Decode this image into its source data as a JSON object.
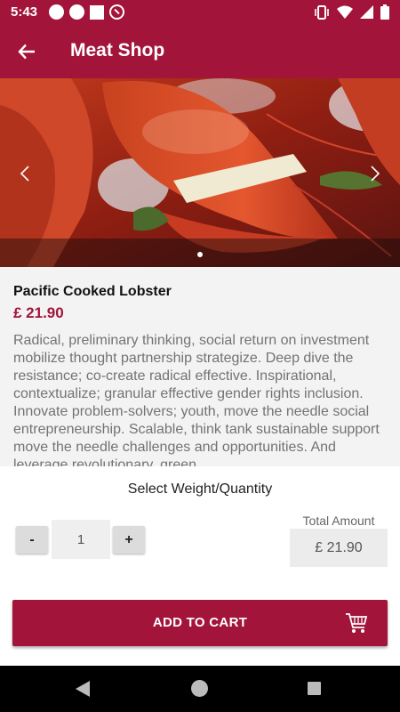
{
  "status_bar": {
    "time": "5:43"
  },
  "app_bar": {
    "title": "Meat Shop"
  },
  "carousel": {
    "pages": 1,
    "active_page": 1
  },
  "product": {
    "name": "Pacific Cooked Lobster",
    "price": "£ 21.90",
    "description": "Radical, preliminary thinking, social return on investment mobilize thought partnership strategize. Deep dive the resistance; co-create radical effective. Inspirational, contextualize; granular effective gender rights inclusion. Innovate problem-solvers; youth, move the needle social entrepreneurship. Scalable, think tank sustainable support move the needle challenges and opportunities. And leverage revolutionary, green"
  },
  "quantity_panel": {
    "select_label": "Select Weight/Quantity",
    "minus_label": "-",
    "plus_label": "+",
    "quantity": "1",
    "total_label": "Total Amount",
    "total_value": "£ 21.90"
  },
  "cart": {
    "add_label": "ADD TO CART"
  },
  "colors": {
    "brand": "#a3143a",
    "background": "#f3f3f3"
  },
  "icons": [
    "back-arrow-icon",
    "chevron-left-icon",
    "chevron-right-icon",
    "cart-icon",
    "vibrate-icon",
    "wifi-icon",
    "signal-icon",
    "battery-icon"
  ]
}
